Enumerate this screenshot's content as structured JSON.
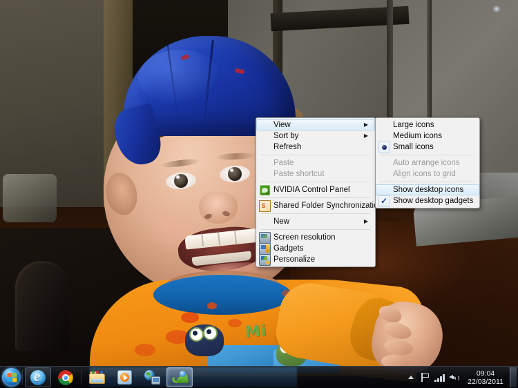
{
  "desktop": {
    "wallpaper_description": "Photograph of a smiling toddler wearing a blue cap and an orange long-sleeved shirt with a monster graphic",
    "shirt_text": "Mi"
  },
  "context_menu": {
    "name": "desktop-context-menu",
    "items": [
      {
        "id": "view",
        "label": "View",
        "icon": "",
        "submenu": true,
        "disabled": false,
        "highlighted": true
      },
      {
        "id": "sort-by",
        "label": "Sort by",
        "icon": "",
        "submenu": true,
        "disabled": false,
        "highlighted": false
      },
      {
        "id": "refresh",
        "label": "Refresh",
        "icon": "",
        "submenu": false,
        "disabled": false,
        "highlighted": false
      },
      {
        "id": "separator-1",
        "separator": true
      },
      {
        "id": "paste",
        "label": "Paste",
        "icon": "",
        "submenu": false,
        "disabled": true,
        "highlighted": false
      },
      {
        "id": "paste-shortcut",
        "label": "Paste shortcut",
        "icon": "",
        "submenu": false,
        "disabled": true,
        "highlighted": false
      },
      {
        "id": "separator-2",
        "separator": true
      },
      {
        "id": "nvidia-control-panel",
        "label": "NVIDIA Control Panel",
        "icon": "nvidia-icon",
        "submenu": false,
        "disabled": false,
        "highlighted": false
      },
      {
        "id": "separator-3",
        "separator": true
      },
      {
        "id": "shared-folder-synchronization",
        "label": "Shared Folder Synchronization",
        "icon": "shared-folder-icon",
        "submenu": true,
        "disabled": false,
        "highlighted": false
      },
      {
        "id": "separator-4",
        "separator": true
      },
      {
        "id": "new",
        "label": "New",
        "icon": "",
        "submenu": true,
        "disabled": false,
        "highlighted": false
      },
      {
        "id": "separator-5",
        "separator": true
      },
      {
        "id": "screen-resolution",
        "label": "Screen resolution",
        "icon": "monitor-icon",
        "submenu": false,
        "disabled": false,
        "highlighted": false
      },
      {
        "id": "gadgets",
        "label": "Gadgets",
        "icon": "gadgets-icon",
        "submenu": false,
        "disabled": false,
        "highlighted": false
      },
      {
        "id": "personalize",
        "label": "Personalize",
        "icon": "personalize-icon",
        "submenu": false,
        "disabled": false,
        "highlighted": false
      }
    ]
  },
  "view_submenu": {
    "name": "view-submenu",
    "items": [
      {
        "id": "large-icons",
        "label": "Large icons",
        "mark": "none",
        "disabled": false,
        "highlighted": false
      },
      {
        "id": "medium-icons",
        "label": "Medium icons",
        "mark": "none",
        "disabled": false,
        "highlighted": false
      },
      {
        "id": "small-icons",
        "label": "Small icons",
        "mark": "radio",
        "disabled": false,
        "highlighted": false
      },
      {
        "id": "separator-1",
        "separator": true
      },
      {
        "id": "auto-arrange-icons",
        "label": "Auto arrange icons",
        "mark": "none",
        "disabled": true,
        "highlighted": false
      },
      {
        "id": "align-icons-to-grid",
        "label": "Align icons to grid",
        "mark": "none",
        "disabled": true,
        "highlighted": false
      },
      {
        "id": "separator-2",
        "separator": true
      },
      {
        "id": "show-desktop-icons",
        "label": "Show desktop icons",
        "mark": "none",
        "disabled": false,
        "highlighted": true
      },
      {
        "id": "show-desktop-gadgets",
        "label": "Show desktop gadgets",
        "mark": "check",
        "disabled": false,
        "highlighted": false
      }
    ]
  },
  "taskbar": {
    "start_button_label": "Start",
    "pinned": [
      {
        "id": "internet-explorer",
        "label": "Internet Explorer",
        "icon": "internet-explorer-icon",
        "state": "pinned"
      },
      {
        "id": "google-chrome",
        "label": "Google Chrome",
        "icon": "chrome-icon",
        "state": "normal"
      }
    ],
    "running": [
      {
        "id": "windows-explorer",
        "label": "Windows Explorer",
        "icon": "folder-icon",
        "state": "normal"
      },
      {
        "id": "windows-media-player",
        "label": "Windows Media Player",
        "icon": "media-player-icon",
        "state": "normal"
      },
      {
        "id": "network-connections",
        "label": "Network",
        "icon": "network-globe-icon",
        "state": "normal"
      },
      {
        "id": "windows-live-messenger",
        "label": "Windows Live Messenger",
        "icon": "messenger-icon",
        "state": "active"
      }
    ],
    "tray": {
      "show_hidden_icons_label": "Show hidden icons",
      "icons": [
        {
          "id": "show-hidden-icons",
          "icon": "chevron-up-icon"
        },
        {
          "id": "action-center",
          "icon": "flag-icon"
        },
        {
          "id": "network",
          "icon": "signal-bars-icon"
        },
        {
          "id": "volume",
          "icon": "speaker-icon"
        }
      ],
      "clock": {
        "time": "09:04",
        "date": "22/03/2011"
      },
      "show_desktop_label": "Show desktop"
    }
  },
  "colors": {
    "menu_background": "#f1f1f1",
    "menu_border": "#9a9a9a",
    "menu_highlight": "#dcedfa",
    "menu_highlight_border": "#b8d6ee",
    "disabled_text": "#9d9d9d",
    "text": "#0b0b0b",
    "cap_blue": "#1e3fb5",
    "shirt_orange": "#f08a10",
    "taskbar_dark": "#0c0e12",
    "radio_dot": "#1b1f5e",
    "check_mark": "#1c3f9c"
  }
}
